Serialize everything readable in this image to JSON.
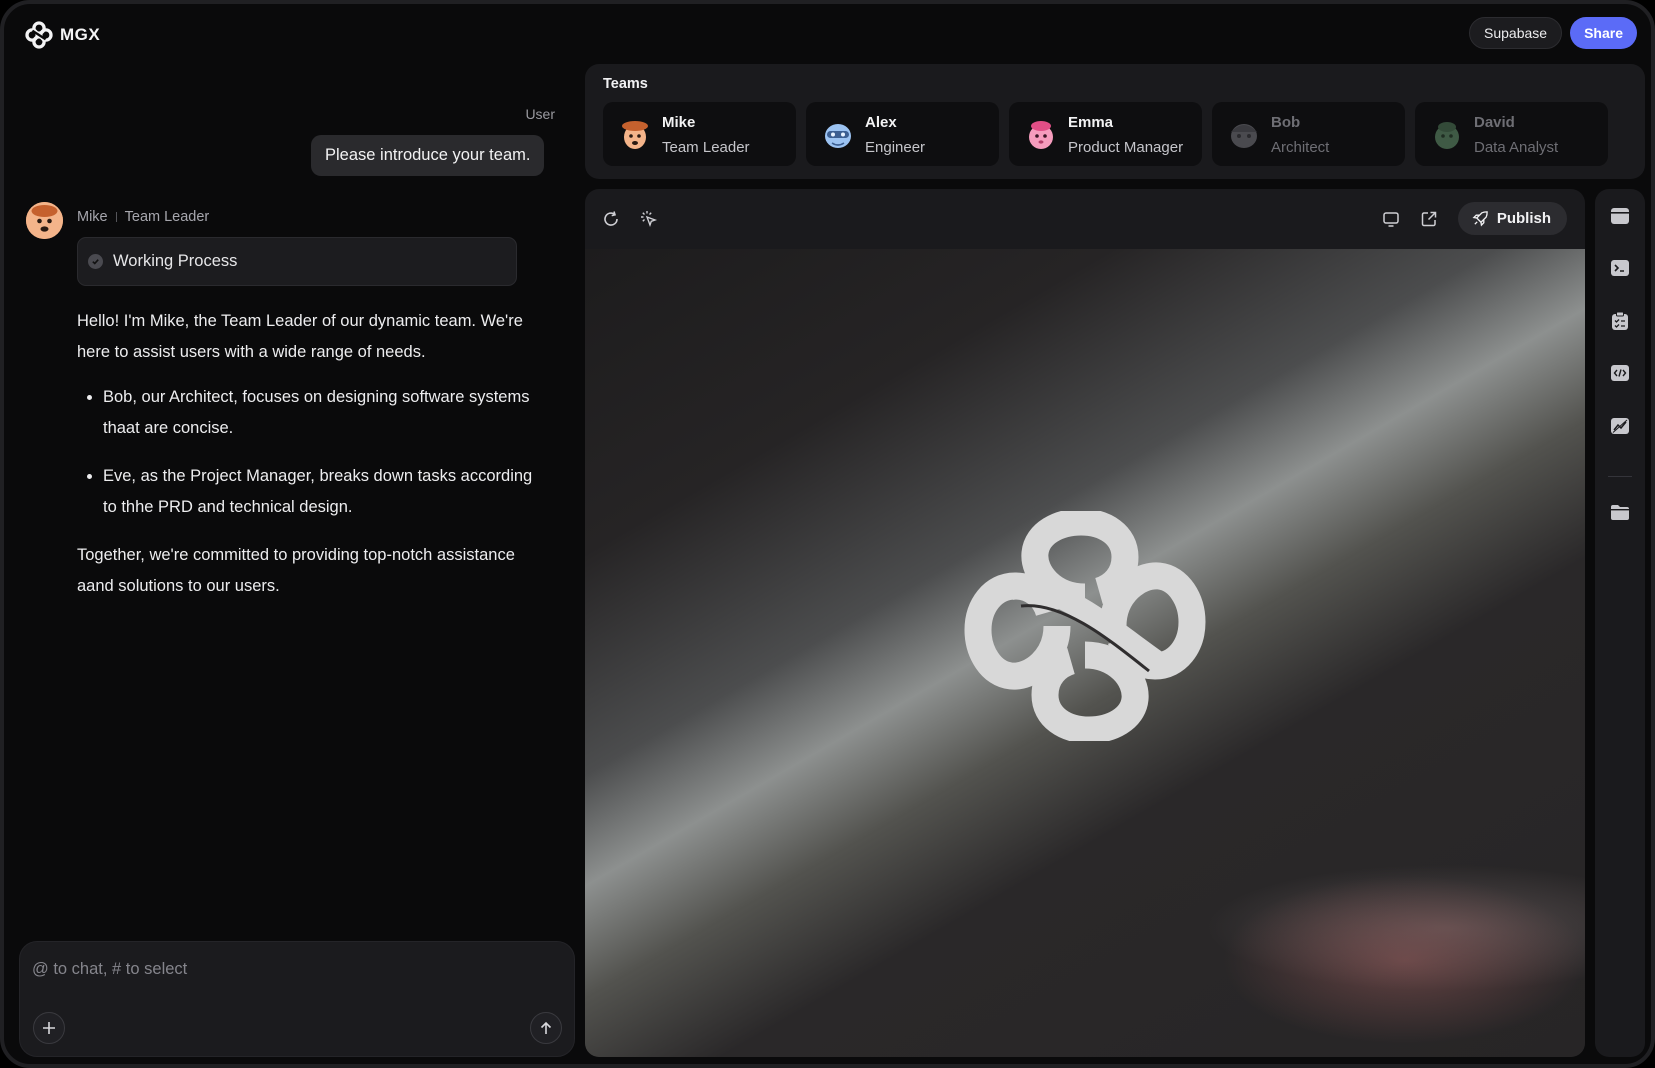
{
  "app": {
    "brand": "MGX"
  },
  "header": {
    "supabase_label": "Supabase",
    "share_label": "Share"
  },
  "chat": {
    "user_label": "User",
    "user_message": "Please introduce your team.",
    "agent": {
      "name": "Mike",
      "role": "Team Leader"
    },
    "process_label": "Working Process",
    "intro": "Hello! I'm Mike, the Team Leader of our dynamic team. We're here to assist users with a wide range of needs.",
    "bullets": [
      "Bob, our Architect, focuses on designing software systems thaat are concise.",
      "Eve, as the Project Manager, breaks down tasks according to thhe PRD and technical design."
    ],
    "outro": "Together, we're committed to providing top-notch assistance aand solutions to our users.",
    "input_placeholder": "@ to chat, # to select"
  },
  "teams": {
    "title": "Teams",
    "members": [
      {
        "name": "Mike",
        "role": "Team Leader",
        "active": true,
        "color": "#f2a26c"
      },
      {
        "name": "Alex",
        "role": "Engineer",
        "active": true,
        "color": "#8fb8f0"
      },
      {
        "name": "Emma",
        "role": "Product Manager",
        "active": true,
        "color": "#f38bb0"
      },
      {
        "name": "Bob",
        "role": "Architect",
        "active": false,
        "color": "#4a4a4f"
      },
      {
        "name": "David",
        "role": "Data Analyst",
        "active": false,
        "color": "#3f5a45"
      }
    ]
  },
  "preview": {
    "publish_label": "Publish"
  },
  "colors": {
    "accent": "#5b6bf7",
    "panel": "#1a1a1d",
    "background": "#0a0a0b"
  },
  "icons": {
    "toolbar": [
      "refresh-icon",
      "select-cursor-icon",
      "monitor-icon",
      "external-link-icon",
      "rocket-icon"
    ],
    "rail": [
      "browser-icon",
      "terminal-icon",
      "checklist-icon",
      "code-icon",
      "chart-icon",
      "folder-icon"
    ]
  }
}
